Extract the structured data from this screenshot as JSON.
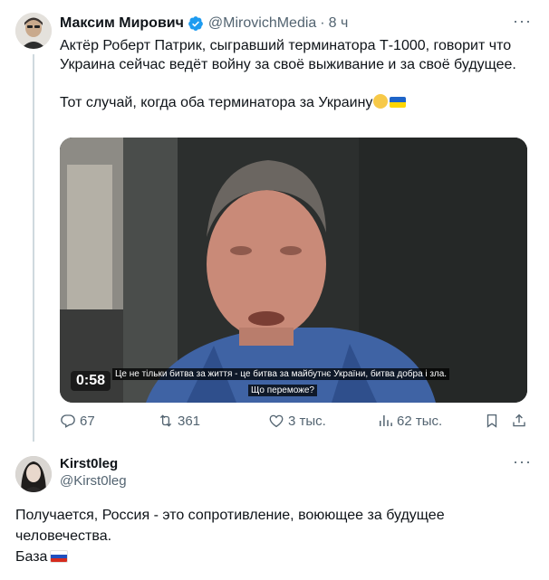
{
  "tweet": {
    "display_name": "Максим Мирович",
    "handle": "@MirovichMedia",
    "separator": "·",
    "time": "8 ч",
    "more_label": "···",
    "text": "Актёр Роберт Патрик, сыгравший терминатора Т-1000, говорит что Украина сейчас ведёт войну за своё выживание и за своё будущее.\n\nТот случай, когда оба терминатора за Украину",
    "emojis": [
      "raised-fist-emoji",
      "ukraine-flag-emoji"
    ],
    "verified_color": "#1d9bf0",
    "video": {
      "duration": "0:58",
      "subtitle_line_1": "Це не тільки битва за життя - це битва за майбутнє України, битва добра і зла.",
      "subtitle_line_2": "Що переможе?"
    },
    "actions": {
      "replies": "67",
      "retweets": "361",
      "likes": "3 тыс.",
      "views": "62 тыс."
    }
  },
  "reply": {
    "display_name": "Kirst0leg",
    "handle": "@Kirst0leg",
    "more_label": "···",
    "text": "Получается, Россия - это сопротивление, воюющее за будущее человечества.\nБаза",
    "emoji": "russia-flag-emoji"
  },
  "colors": {
    "text": "#0f1419",
    "secondary": "#536471",
    "accent": "#1d9bf0",
    "divider": "#cfd9de"
  }
}
